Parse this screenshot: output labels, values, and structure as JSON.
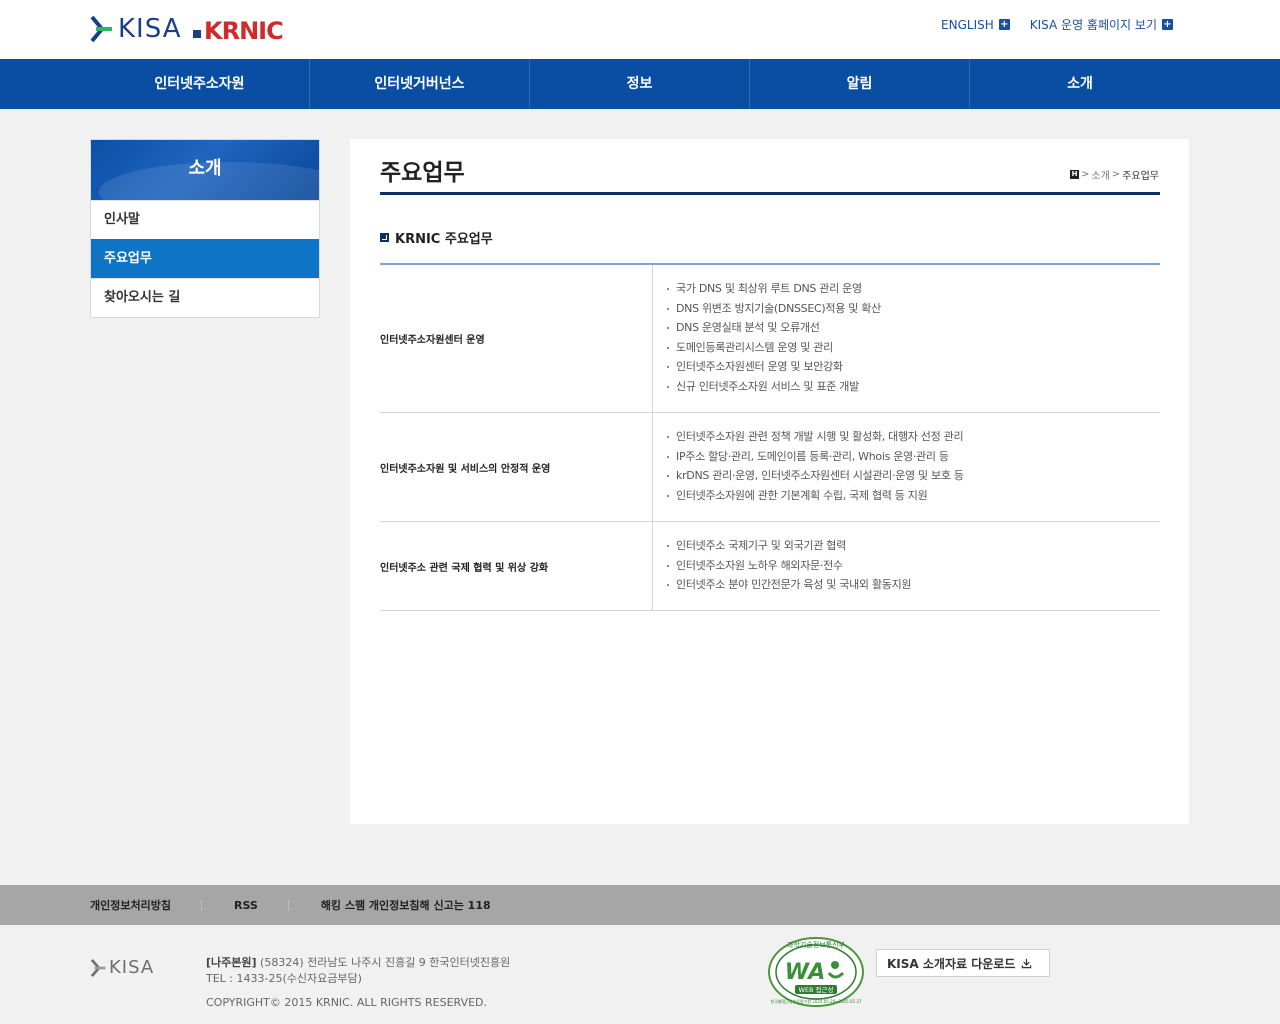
{
  "header": {
    "logo_kisa": "KISA",
    "logo_krnic": "KRNIC",
    "util": [
      {
        "label": "ENGLISH"
      },
      {
        "label": "KISA 운영 홈페이지 보기"
      }
    ]
  },
  "gnb": [
    "인터넷주소자원",
    "인터넷거버넌스",
    "정보",
    "알림",
    "소개"
  ],
  "sidebar": {
    "title": "소개",
    "items": [
      {
        "label": "인사말",
        "active": false
      },
      {
        "label": "주요업무",
        "active": true
      },
      {
        "label": "찾아오시는 길",
        "active": false
      }
    ]
  },
  "content": {
    "page_title": "주요업무",
    "breadcrumb": {
      "home": "H",
      "items": [
        "소개",
        "주요업무"
      ],
      "sep": ">"
    },
    "section_title": "KRNIC 주요업무",
    "rows": [
      {
        "title": "인터넷주소자원센터 운영",
        "items": [
          "국가 DNS 및 최상위 루트 DNS 관리 운영",
          "DNS 위변조 방지기술(DNSSEC)적용 및 확산",
          "DNS 운영실태 분석 및 오류개선",
          "도메인등록관리시스템 운영 및 관리",
          "인터넷주소자원센터 운영 및 보안강화",
          "신규 인터넷주소자원 서비스 및 표준 개발"
        ]
      },
      {
        "title": "인터넷주소자원 및 서비스의 안정적 운영",
        "items": [
          "인터넷주소자원 관련 정책 개발 시행 및 활성화, 대행자 선정 관리",
          "IP주소 할당·관리, 도메인이름 등록·관리, Whois 운영·관리 등",
          "krDNS 관리·운영, 인터넷주소자원센터 시설관리·운영 및 보호 등",
          "인터넷주소자원에 관한 기본계획 수립, 국제 협력 등 지원"
        ]
      },
      {
        "title": "인터넷주소 관련 국제 협력 및 위상 강화",
        "items": [
          "인터넷주소 국제기구 및 외국기관 협력",
          "인터넷주소자원 노하우 해외자문·전수",
          "인터넷주소 분야 민간전문가 육성 및 국내외 활동지원"
        ]
      }
    ]
  },
  "footer": {
    "links": [
      "개인정보처리방침",
      "RSS",
      "해킹 스팸 개인정보침해 신고는 118"
    ],
    "logo": "KISA",
    "address_label": "[나주본원]",
    "address": "(58324) 전라남도 나주시 진흥길 9 한국인터넷진흥원",
    "tel": "TEL : 1433-25(수신자요금부담)",
    "copyright": "COPYRIGHT© 2015 KRNIC. ALL RIGHTS RESERVED.",
    "wa_mark": {
      "top": "과학기술정보통신부",
      "main": "WA",
      "sub": "WEB 접근성",
      "bottom": "한국웹접근성인증평가원 2024.05.28~2025.05.27"
    },
    "download_label": "KISA 소개자료 다운로드"
  },
  "colors": {
    "primary": "#0a4ea3",
    "active": "#0e74c7",
    "navy": "#0d2f66"
  }
}
